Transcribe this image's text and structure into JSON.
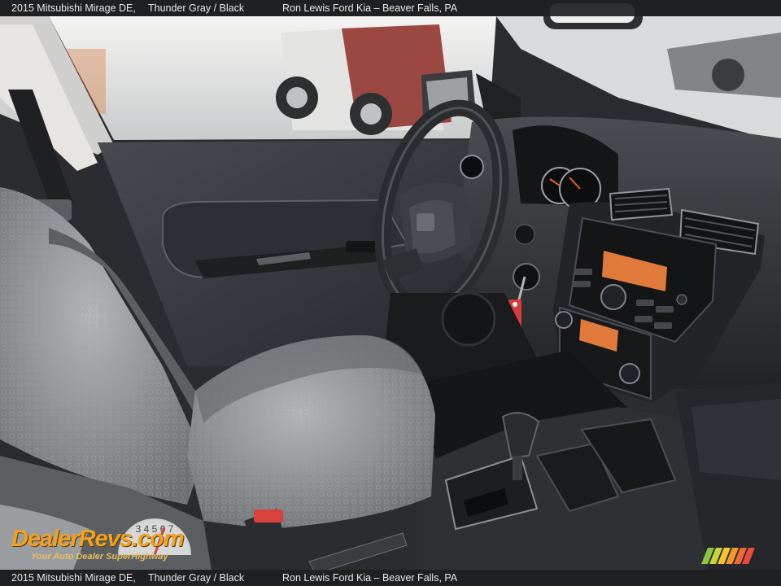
{
  "caption": {
    "model": "2015 Mitsubishi Mirage DE,",
    "color": "Thunder Gray / Black",
    "dealer": "Ron Lewis Ford Kia – Beaver Falls, PA"
  },
  "watermark": {
    "brand": "DealerRevs.com",
    "tagline": "Your Auto Dealer SuperHighway",
    "gauge_digits": "3 4 5 6 7"
  },
  "scene": {
    "subject": "car interior, driver side",
    "colors": {
      "seat_fabric": "#8e9194",
      "door_panel": "#3a3d41",
      "dashboard": "#2b2d30",
      "display_amber": "#e07a3a",
      "key_tag_red": "#d83c3c",
      "seatbelt_buckle": "#d9413d"
    }
  }
}
